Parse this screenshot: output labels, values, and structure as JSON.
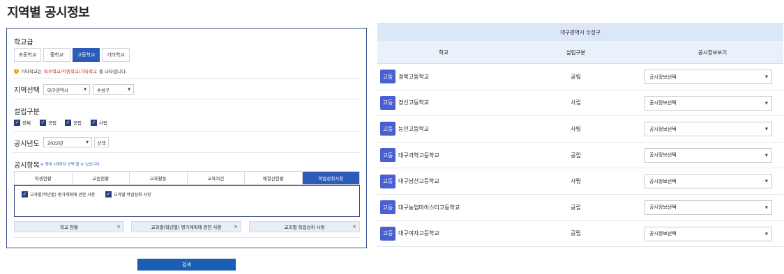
{
  "page_title": "지역별 공시정보",
  "filter": {
    "school_level_label": "학교급",
    "school_levels": [
      "초등학교",
      "중학교",
      "고등학교",
      "기타학교"
    ],
    "info_text_pre": "기타학교는",
    "info_text_hl": "특수학교/각종학교/기타학교",
    "info_text_post": "를 나타냅니다.",
    "region_label": "지역선택",
    "region_city": "대구광역시",
    "region_district": "수성구",
    "est_label": "설립구분",
    "est_options": [
      "전체",
      "국립",
      "공립",
      "사립"
    ],
    "year_label": "공시년도",
    "year_value": "2022년",
    "year_select": "선택",
    "items_label": "공시항목",
    "items_note": "※ 최대 3개까지 선택 할 수 있습니다.",
    "tabs": [
      "학생현황",
      "교원현황",
      "교육활동",
      "교육여건",
      "예결산현황",
      "학업성취사항"
    ],
    "tab_checks": [
      "교과별(학년별) 평가계획에 관한 사항",
      "교과별 학업성취 사항"
    ],
    "tags": [
      "학교 현황",
      "교과별(학년별) 평가계획에 관한 사항",
      "교과별 학업성취 사항"
    ],
    "search_label": "검색"
  },
  "results": {
    "region_header": "대구광역시 수성구",
    "columns": [
      "학교",
      "설립구분",
      "공시정보보기"
    ],
    "rows": [
      {
        "badge": "고등",
        "name": "경북고등학교",
        "type": "공립",
        "select": "공시정보선택"
      },
      {
        "badge": "고등",
        "name": "경신고등학교",
        "type": "사립",
        "select": "공시정보선택"
      },
      {
        "badge": "고등",
        "name": "능인고등학교",
        "type": "사립",
        "select": "공시정보선택"
      },
      {
        "badge": "고등",
        "name": "대구과학고등학교",
        "type": "공립",
        "select": "공시정보선택"
      },
      {
        "badge": "고등",
        "name": "대구남산고등학교",
        "type": "사립",
        "select": "공시정보선택"
      },
      {
        "badge": "고등",
        "name": "대구농업마이스터고등학교",
        "type": "공립",
        "select": "공시정보선택"
      },
      {
        "badge": "고등",
        "name": "대구여자고등학교",
        "type": "공립",
        "select": "공시정보선택"
      }
    ]
  },
  "colors": {
    "accent": "#2c5cb8",
    "badge": "#4a5fd0",
    "search": "#1a5fb4"
  }
}
